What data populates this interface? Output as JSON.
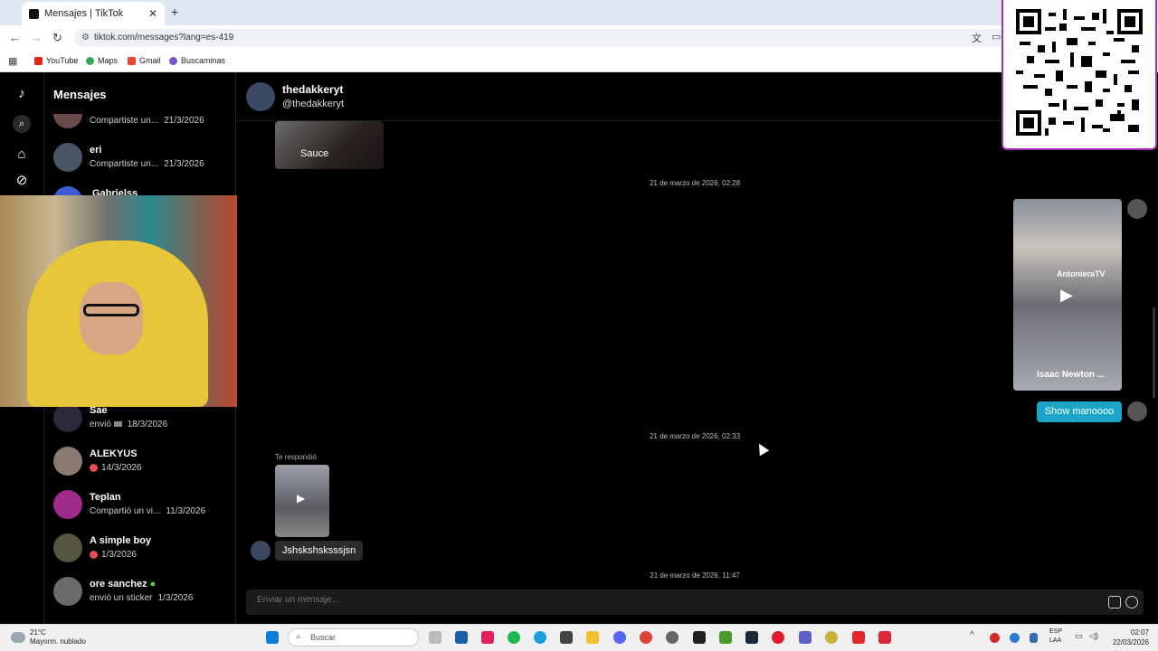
{
  "browser": {
    "tab_title": "Mensajes | TikTok",
    "url": "tiktok.com/messages?lang=es-419",
    "bookmarks": [
      {
        "label": "YouTube",
        "color": "#e62117"
      },
      {
        "label": "Maps",
        "color": "#34a853"
      },
      {
        "label": "Gmail",
        "color": "#ea4335"
      },
      {
        "label": "Buscaminas",
        "color": "#7b52c9"
      }
    ]
  },
  "sidebar": {
    "title": "Mensajes",
    "conversations": [
      {
        "name": "",
        "preview": "Compartiste un...",
        "date": "21/3/2026",
        "avatar_color": "#6b4a4a"
      },
      {
        "name": "eri",
        "preview": "Compartiste un...",
        "date": "21/3/2026",
        "avatar_color": "#4a5566"
      },
      {
        "name": "Gabrielss",
        "preview": "",
        "date": "",
        "avatar_color": "#3b5bd6"
      },
      {
        "name": "Sae",
        "preview": "envió",
        "date": "18/3/2026",
        "avatar_color": "#2a2a3a"
      },
      {
        "name": "ALEKYUS",
        "preview": "",
        "date": "14/3/2026",
        "avatar_color": "#8a7a70"
      },
      {
        "name": "Teplan",
        "preview": "Compartió un vi...",
        "date": "11/3/2026",
        "avatar_color": "#a02a8a"
      },
      {
        "name": "A simple boy",
        "preview": "",
        "date": "1/3/2026",
        "avatar_color": "#555540"
      },
      {
        "name": "ore sanchez",
        "preview": "envió un sticker",
        "date": "1/3/2026",
        "avatar_color": "#6a6a6a"
      }
    ]
  },
  "chat": {
    "name": "thedakkeryt",
    "handle": "@thedakkeryt",
    "shared_video_label": "Sauce",
    "timestamps": [
      "21 de marzo de 2026, 02:28",
      "21 de marzo de 2026, 02:33",
      "21 de marzo de 2026, 11:47"
    ],
    "video_card": {
      "channel": "AntonieraTV",
      "caption": "Isaac Newton ..."
    },
    "sent_message": "Show manoooo",
    "replied_label": "Te respondió",
    "received_message": "Jshskshsksssjsn",
    "input_placeholder": "Enviar un mensaje..."
  },
  "taskbar": {
    "weather_temp": "21°C",
    "weather_desc": "Mayorm. nublado",
    "search_placeholder": "Buscar",
    "lang_1": "ESP",
    "lang_2": "LAA",
    "time": "02:07",
    "date": "22/03/2026"
  }
}
